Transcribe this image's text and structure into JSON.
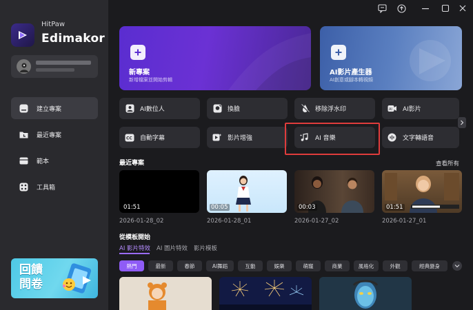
{
  "brand": {
    "sub": "HitPaw",
    "main": "Edimakor"
  },
  "nav": [
    {
      "label": "建立專案",
      "icon": "create-project-icon",
      "active": true
    },
    {
      "label": "最近專案",
      "icon": "recent-folder-icon",
      "active": false
    },
    {
      "label": "範本",
      "icon": "template-icon",
      "active": false
    },
    {
      "label": "工具箱",
      "icon": "toolbox-icon",
      "active": false
    }
  ],
  "promo": {
    "line1": "回饋",
    "line2": "問卷"
  },
  "hero": {
    "new_project": {
      "title": "新專案",
      "subtitle": "新增檔案並開始剪輯"
    },
    "ai_video": {
      "title": "AI影片產生器",
      "subtitle": "AI創意或腳本轉視頻"
    }
  },
  "tools": [
    {
      "label": "AI數位人",
      "icon": "digital-human-icon"
    },
    {
      "label": "換臉",
      "icon": "face-swap-icon"
    },
    {
      "label": "移除浮水印",
      "icon": "watermark-remove-icon"
    },
    {
      "label": "AI影片",
      "icon": "ai-video-icon"
    },
    {
      "label": "自動字幕",
      "icon": "cc-subtitle-icon"
    },
    {
      "label": "影片增強",
      "icon": "video-enhance-icon"
    },
    {
      "label": "AI 音樂",
      "icon": "ai-music-icon"
    },
    {
      "label": "文字轉語音",
      "icon": "text-to-speech-icon"
    }
  ],
  "recent": {
    "title": "最近專案",
    "see_all": "查看所有",
    "items": [
      {
        "duration": "01:51",
        "date": "2026-01-28_02"
      },
      {
        "duration": "00:05",
        "date": "2026-01-28_01"
      },
      {
        "duration": "00:03",
        "date": "2026-01-27_02"
      },
      {
        "duration": "01:51",
        "date": "2026-01-27_01"
      }
    ]
  },
  "templates": {
    "title": "從模板開始",
    "tabs": [
      "AI 影片特效",
      "AI 圖片特效",
      "影片模板"
    ],
    "chips": [
      "熱門",
      "最新",
      "春節",
      "AI舞蹈",
      "互動",
      "娛樂",
      "萌寵",
      "商業",
      "風格化",
      "外觀",
      "經典變身"
    ]
  },
  "colors": {
    "accent": "#8f5cf6",
    "highlight_box": "#e03c3c",
    "background": "#1b1b1e",
    "sidebar": "#2a2a2e"
  }
}
